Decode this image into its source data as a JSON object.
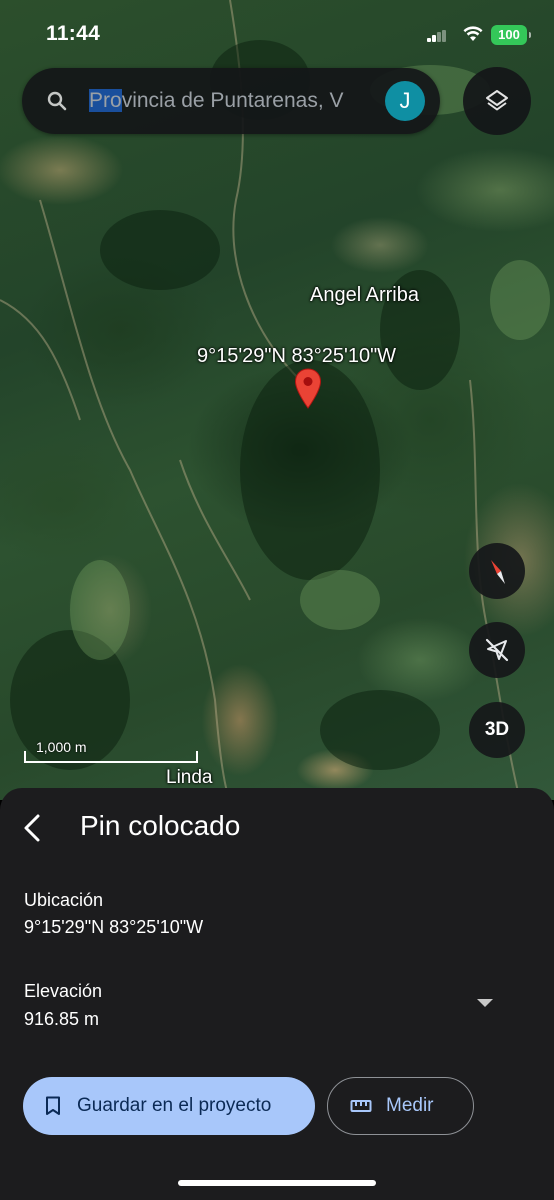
{
  "status_bar": {
    "time": "11:44",
    "battery": "100"
  },
  "search": {
    "text_selected": "Pro",
    "text_rest": "vincia de Puntarenas, V",
    "avatar_initial": "J"
  },
  "map": {
    "place_labels": [
      "Angel Arriba",
      "Linda"
    ],
    "pin_coordinates": "9°15'29\"N 83°25'10\"W",
    "scale": "1,000 m",
    "button_3d": "3D"
  },
  "sheet": {
    "title": "Pin colocado",
    "location_label": "Ubicación",
    "location_value": "9°15'29\"N 83°25'10\"W",
    "elevation_label": "Elevación",
    "elevation_value": "916.85 m",
    "save_label": "Guardar en el proyecto",
    "measure_label": "Medir"
  },
  "colors": {
    "accent": "#a8c7fa",
    "pin": "#ea4335",
    "avatar": "#0f8fa3",
    "battery": "#34c759"
  },
  "icons": [
    "search-icon",
    "layers-icon",
    "map-pin-icon",
    "compass-icon",
    "location-off-icon",
    "back-arrow-icon",
    "dropdown-icon",
    "bookmark-icon",
    "ruler-icon"
  ]
}
